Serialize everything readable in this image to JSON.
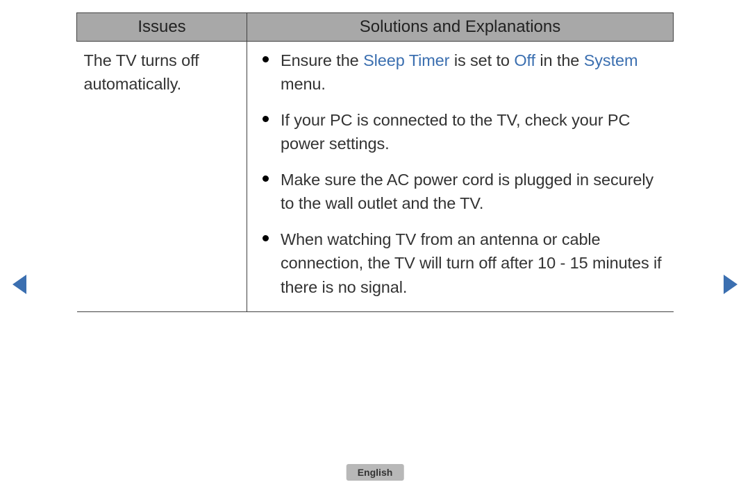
{
  "table": {
    "headers": {
      "issues": "Issues",
      "solutions": "Solutions and Explanations"
    },
    "row": {
      "issue": "The TV turns off automatically.",
      "solutions": {
        "s0": {
          "segs": {
            "a": "Ensure the ",
            "b": "Sleep Timer",
            "c": " is set to ",
            "d": "Off",
            "e": " in the ",
            "f": "System",
            "g": " menu."
          }
        },
        "s1": {
          "text": "If your PC is connected to the TV, check your PC power settings."
        },
        "s2": {
          "text": "Make sure the AC power cord is plugged in securely to the wall outlet and the TV."
        },
        "s3": {
          "text": "When watching TV from an antenna or cable connection, the TV will turn off after 10 - 15 minutes if there is no signal."
        }
      }
    }
  },
  "footer": {
    "language": "English"
  }
}
